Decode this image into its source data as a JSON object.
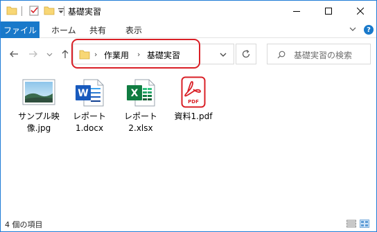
{
  "window": {
    "title": "基礎実習",
    "controls": [
      "minimize",
      "maximize",
      "close"
    ]
  },
  "ribbon": {
    "file_tab": "ファイル",
    "tabs": [
      "ホーム",
      "共有",
      "表示"
    ]
  },
  "address_bar": {
    "crumbs": [
      "作業用",
      "基礎実習"
    ],
    "highlight_color": "#d91f26"
  },
  "search": {
    "placeholder": "基礎実習の検索"
  },
  "files": [
    {
      "name_line1": "サンプル映",
      "name_line2": "像.jpg",
      "icon": "image-file-icon"
    },
    {
      "name_line1": "レポート",
      "name_line2": "1.docx",
      "icon": "word-file-icon"
    },
    {
      "name_line1": "レポート",
      "name_line2": "2.xlsx",
      "icon": "excel-file-icon"
    },
    {
      "name_line1": "資料1.pdf",
      "name_line2": "",
      "icon": "pdf-file-icon"
    }
  ],
  "status": {
    "item_count": "4 個の項目"
  },
  "colors": {
    "accent": "#1979ca",
    "word": "#185abd",
    "excel": "#107c41",
    "pdf": "#d91f26",
    "folder": "#f8d775"
  }
}
